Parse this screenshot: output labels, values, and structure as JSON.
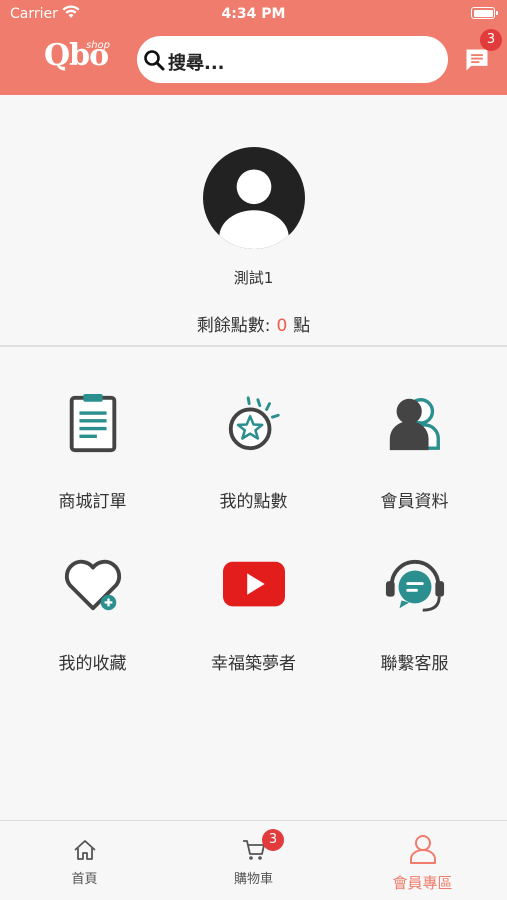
{
  "status_bar": {
    "carrier": "Carrier",
    "time": "4:34 PM"
  },
  "header": {
    "logo_text": "Qbo",
    "logo_sub": "shop",
    "search_placeholder": "搜尋...",
    "message_badge": "3",
    "accent_color": "#ef7c6c"
  },
  "profile": {
    "username": "測試1",
    "points_label": "剩餘點數:",
    "points_value": "0",
    "points_unit": "點"
  },
  "menu": [
    {
      "label": "商城訂單",
      "icon": "clipboard-icon"
    },
    {
      "label": "我的點數",
      "icon": "star-badge-icon"
    },
    {
      "label": "會員資料",
      "icon": "members-icon"
    },
    {
      "label": "我的收藏",
      "icon": "heart-plus-icon"
    },
    {
      "label": "幸福築夢者",
      "icon": "youtube-icon"
    },
    {
      "label": "聯繫客服",
      "icon": "headset-icon"
    }
  ],
  "tabbar": {
    "home": "首頁",
    "cart": "購物車",
    "cart_badge": "3",
    "member": "會員專區",
    "active_color": "#ef7c6c"
  }
}
